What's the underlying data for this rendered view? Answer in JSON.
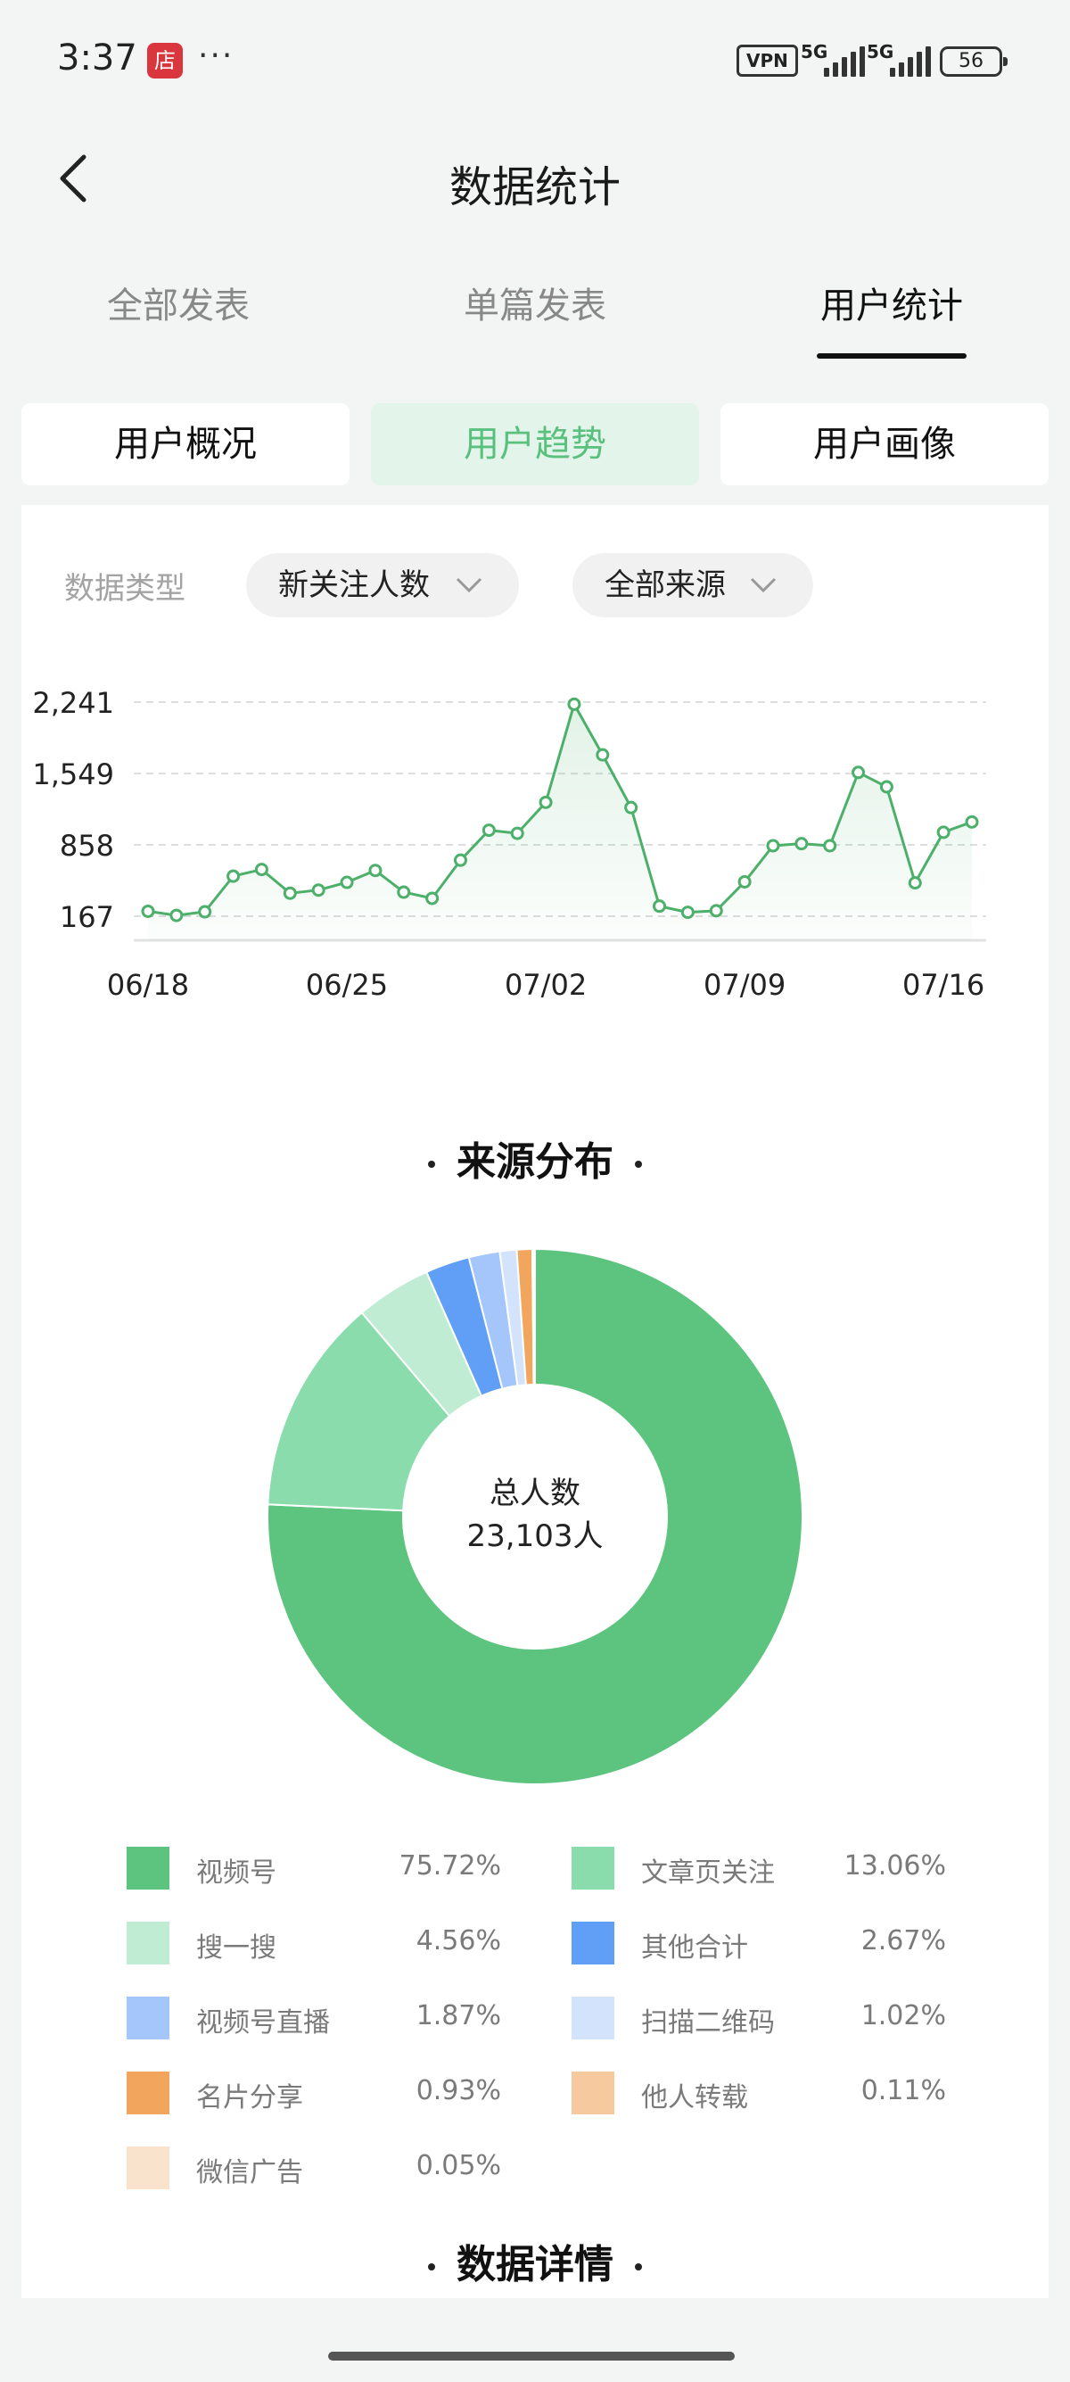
{
  "status_bar": {
    "time": "3:37",
    "shop_badge": "店",
    "more": "···",
    "vpn": "VPN",
    "signal_1": "5G",
    "signal_2": "5G",
    "battery": "56"
  },
  "nav": {
    "title": "数据统计",
    "back_icon": "chevron-left-icon"
  },
  "top_tabs": [
    {
      "label": "全部发表",
      "active": false
    },
    {
      "label": "单篇发表",
      "active": false
    },
    {
      "label": "用户统计",
      "active": true
    }
  ],
  "sub_tabs": [
    {
      "label": "用户概况",
      "active": false
    },
    {
      "label": "用户趋势",
      "active": true
    },
    {
      "label": "用户画像",
      "active": false
    }
  ],
  "filters": {
    "label": "数据类型",
    "type_select": "新关注人数",
    "source_select": "全部来源"
  },
  "chart_data": [
    {
      "type": "line",
      "color": "#4caf6a",
      "ytick_labels": [
        "2,241",
        "1,549",
        "858",
        "167"
      ],
      "yticks": [
        2241,
        1549,
        858,
        167
      ],
      "ylim": [
        167,
        2241
      ],
      "grid": true,
      "x_tick_labels": [
        "06/18",
        "06/25",
        "07/02",
        "07/09",
        "07/16"
      ],
      "x": [
        "06/18",
        "06/19",
        "06/20",
        "06/21",
        "06/22",
        "06/23",
        "06/24",
        "06/25",
        "06/26",
        "06/27",
        "06/28",
        "06/29",
        "06/30",
        "07/01",
        "07/02",
        "07/03",
        "07/04",
        "07/05",
        "07/06",
        "07/07",
        "07/08",
        "07/09",
        "07/10",
        "07/11",
        "07/12",
        "07/13",
        "07/14",
        "07/15",
        "07/16",
        "07/17"
      ],
      "values": [
        215,
        175,
        210,
        555,
        620,
        390,
        420,
        495,
        610,
        400,
        340,
        710,
        1000,
        970,
        1270,
        2220,
        1730,
        1220,
        265,
        205,
        220,
        500,
        850,
        870,
        850,
        1560,
        1420,
        490,
        980,
        1080
      ]
    },
    {
      "type": "pie",
      "donut": true,
      "center_label": "总人数",
      "center_value": "23,103人",
      "slices": [
        {
          "name": "视频号",
          "value": 75.72,
          "display": "75.72%",
          "color": "#5cc47e"
        },
        {
          "name": "文章页关注",
          "value": 13.06,
          "display": "13.06%",
          "color": "#8adcac"
        },
        {
          "name": "搜一搜",
          "value": 4.56,
          "display": "4.56%",
          "color": "#c0ecd4"
        },
        {
          "name": "其他合计",
          "value": 2.67,
          "display": "2.67%",
          "color": "#619ff6"
        },
        {
          "name": "视频号直播",
          "value": 1.87,
          "display": "1.87%",
          "color": "#a4c6fa"
        },
        {
          "name": "扫描二维码",
          "value": 1.02,
          "display": "1.02%",
          "color": "#d3e3fc"
        },
        {
          "name": "名片分享",
          "value": 0.93,
          "display": "0.93%",
          "color": "#f2a55c"
        },
        {
          "name": "他人转载",
          "value": 0.11,
          "display": "0.11%",
          "color": "#f6c99e"
        },
        {
          "name": "微信广告",
          "value": 0.05,
          "display": "0.05%",
          "color": "#fae3cc"
        }
      ]
    }
  ],
  "sections": {
    "source_title": "来源分布",
    "detail_title": "数据详情"
  }
}
